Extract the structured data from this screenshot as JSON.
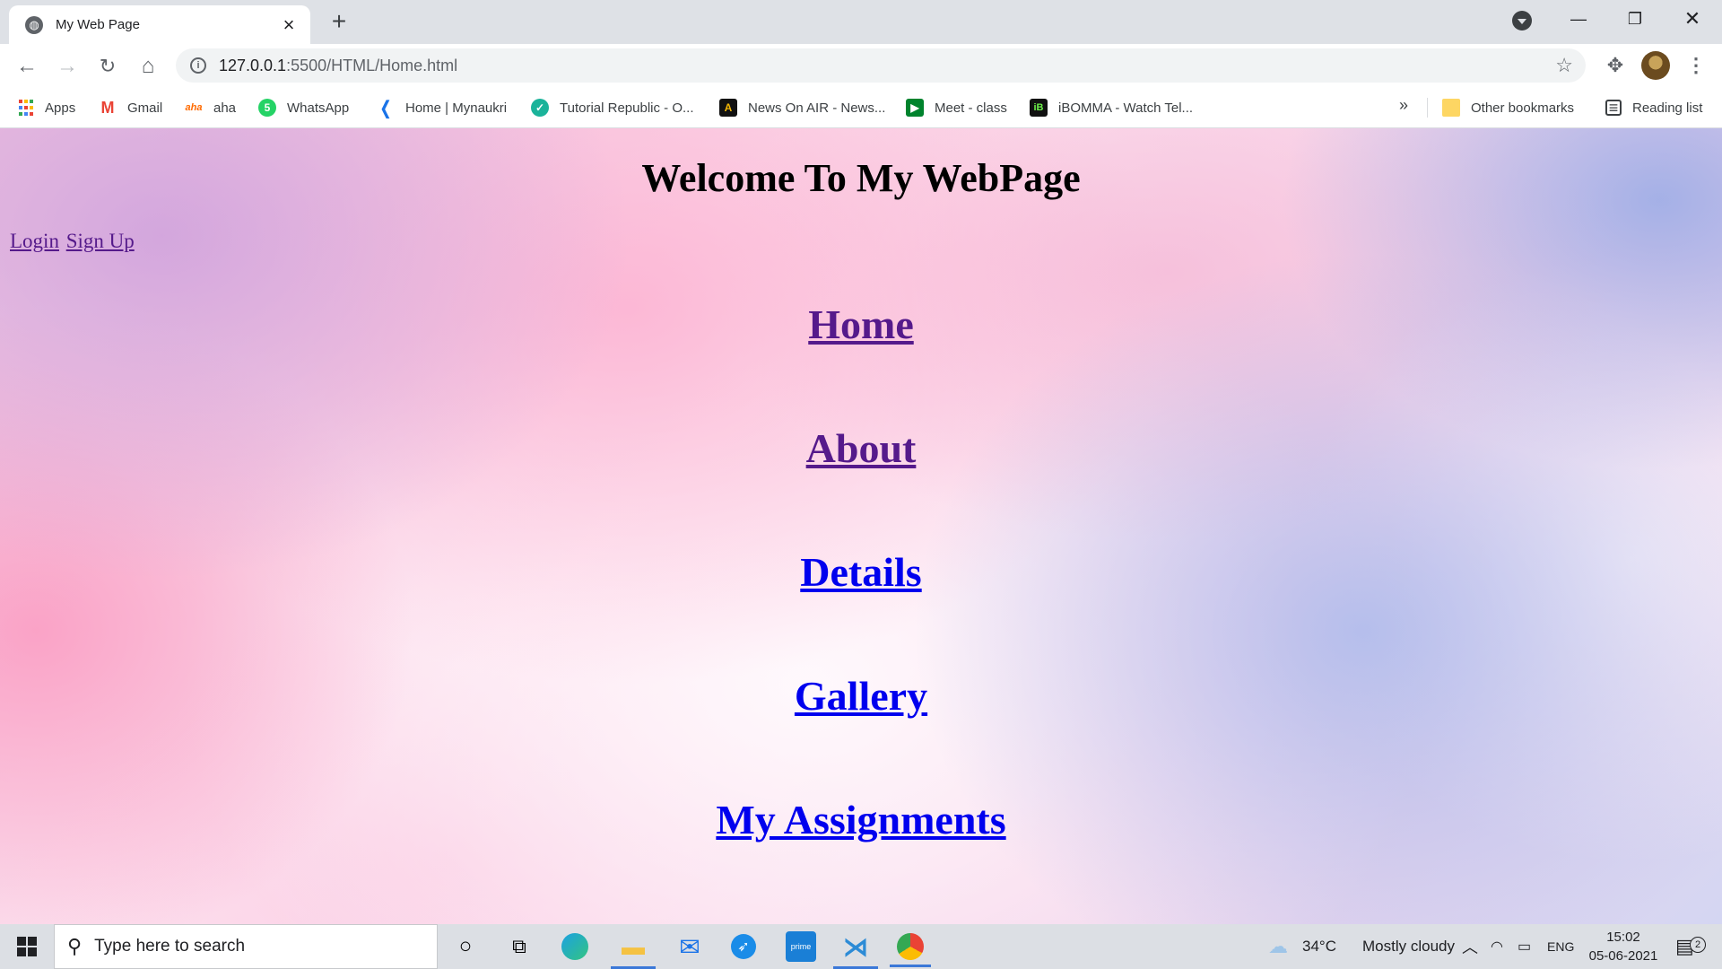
{
  "browser": {
    "tab_title": "My Web Page",
    "tab_close": "×",
    "new_tab": "+",
    "win_minimize": "—",
    "win_maximize": "❐",
    "win_close": "✕",
    "url_host": "127.0.0.1",
    "url_path": ":5500/HTML/Home.html",
    "info": "i"
  },
  "bookmarks": {
    "items": [
      {
        "label": "Apps",
        "icon": "apps-grid-icon",
        "color": "#ea4335"
      },
      {
        "label": "Gmail",
        "icon": "gmail-icon",
        "color": "#ea4335"
      },
      {
        "label": "aha",
        "icon": "aha-icon",
        "color": "#ff6a00"
      },
      {
        "label": "WhatsApp",
        "icon": "whatsapp-icon",
        "color": "#25d366"
      },
      {
        "label": "Home | Mynaukri",
        "icon": "mynaukri-icon",
        "color": "#1a73e8"
      },
      {
        "label": "Tutorial Republic - O...",
        "icon": "tutorial-republic-icon",
        "color": "#1bb39a"
      },
      {
        "label": "News On AIR - News...",
        "icon": "news-on-air-icon",
        "color": "#f2b705"
      },
      {
        "label": "Meet - class",
        "icon": "meet-icon",
        "color": "#00832d"
      },
      {
        "label": "iBOMMA - Watch Tel...",
        "icon": "ibomma-icon",
        "color": "#111111"
      }
    ],
    "more": "»",
    "other": "Other bookmarks",
    "reading_list": "Reading list"
  },
  "page": {
    "heading": "Welcome To My WebPage",
    "auth_links": [
      "Login",
      "Sign Up"
    ],
    "nav": [
      {
        "label": "Home",
        "visited": true
      },
      {
        "label": "About",
        "visited": true
      },
      {
        "label": "Details",
        "visited": false
      },
      {
        "label": "Gallery",
        "visited": false
      },
      {
        "label": "My Assignments",
        "visited": false
      }
    ]
  },
  "taskbar": {
    "search_placeholder": "Type here to search",
    "weather_temp": "34°C",
    "weather_desc": "Mostly cloudy",
    "language": "ENG",
    "time": "15:02",
    "date": "05-06-2021",
    "notifications": "2"
  }
}
